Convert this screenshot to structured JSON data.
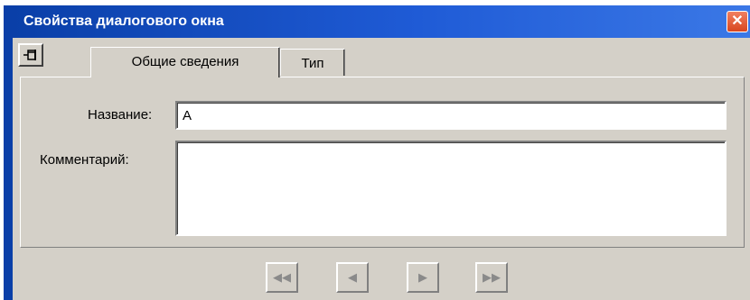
{
  "window": {
    "title": "Свойства диалогового окна",
    "close_glyph": "✕"
  },
  "pin": {
    "icon": "pin-icon"
  },
  "tabs": [
    {
      "label": "Общие сведения",
      "active": true
    },
    {
      "label": "Тип",
      "active": false
    }
  ],
  "form": {
    "name_label": "Название:",
    "name_value": "А",
    "comment_label": "Комментарий:",
    "comment_value": ""
  },
  "nav": {
    "first": "◀◀",
    "prev": "◀",
    "next": "▶",
    "last": "▶▶"
  },
  "colors": {
    "titlebar": "#0a3fa8",
    "face": "#d4d0c8",
    "close": "#d8461f"
  }
}
